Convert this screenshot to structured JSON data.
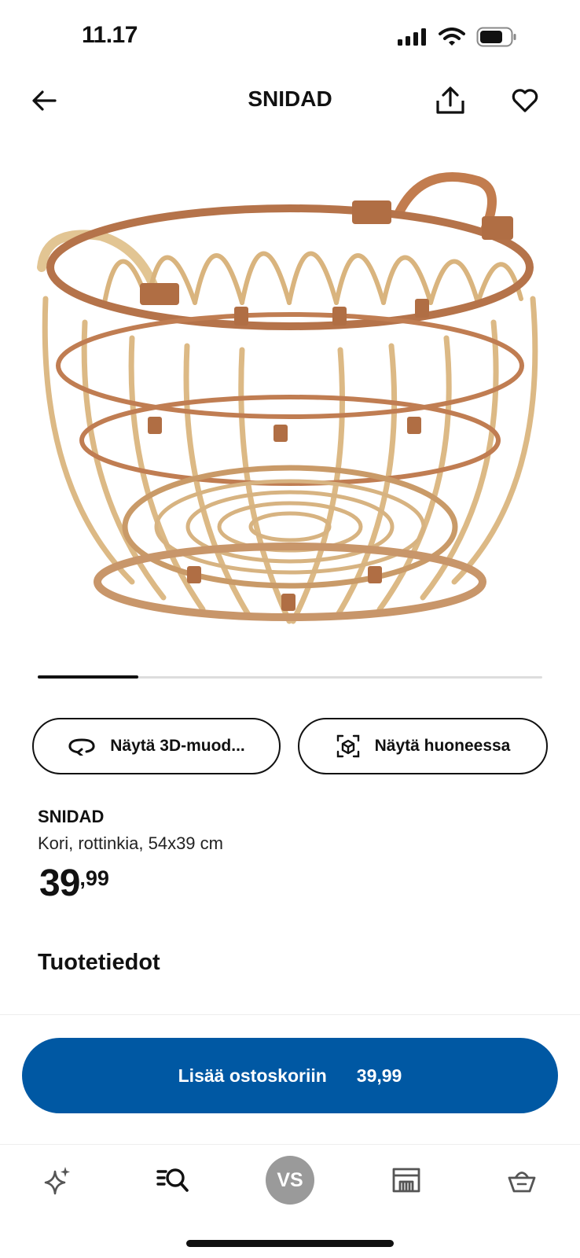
{
  "status_bar": {
    "time": "11.17",
    "icons": [
      "cellular-signal-icon",
      "wifi-icon",
      "battery-icon"
    ]
  },
  "header": {
    "title": "SNIDAD",
    "icons": {
      "back": "arrow-left-icon",
      "share": "share-icon",
      "favorite": "heart-icon"
    }
  },
  "gallery": {
    "image": "rattan-basket",
    "progress": 0.2
  },
  "actions": {
    "view_3d_label": "Näytä 3D-muod...",
    "view_in_room_label": "Näytä huoneessa"
  },
  "product": {
    "name": "SNIDAD",
    "description": "Kori, rottinkia, 54x39 cm",
    "price_integer": "39",
    "price_decimal": ",99"
  },
  "section": {
    "title": "Tuotetiedot"
  },
  "cart_button": {
    "label": "Lisää ostoskoriin",
    "price": "39,99"
  },
  "bottom_nav": {
    "items": [
      {
        "icon": "sparkle-icon"
      },
      {
        "icon": "search-list-icon"
      },
      {
        "avatar_text": "VS"
      },
      {
        "icon": "store-icon"
      },
      {
        "icon": "basket-icon"
      }
    ]
  },
  "colors": {
    "primary": "#0058a3",
    "avatar_bg": "#9a9a9a",
    "rattan_light": "#ddc08c",
    "rattan_dark": "#b06e44"
  }
}
